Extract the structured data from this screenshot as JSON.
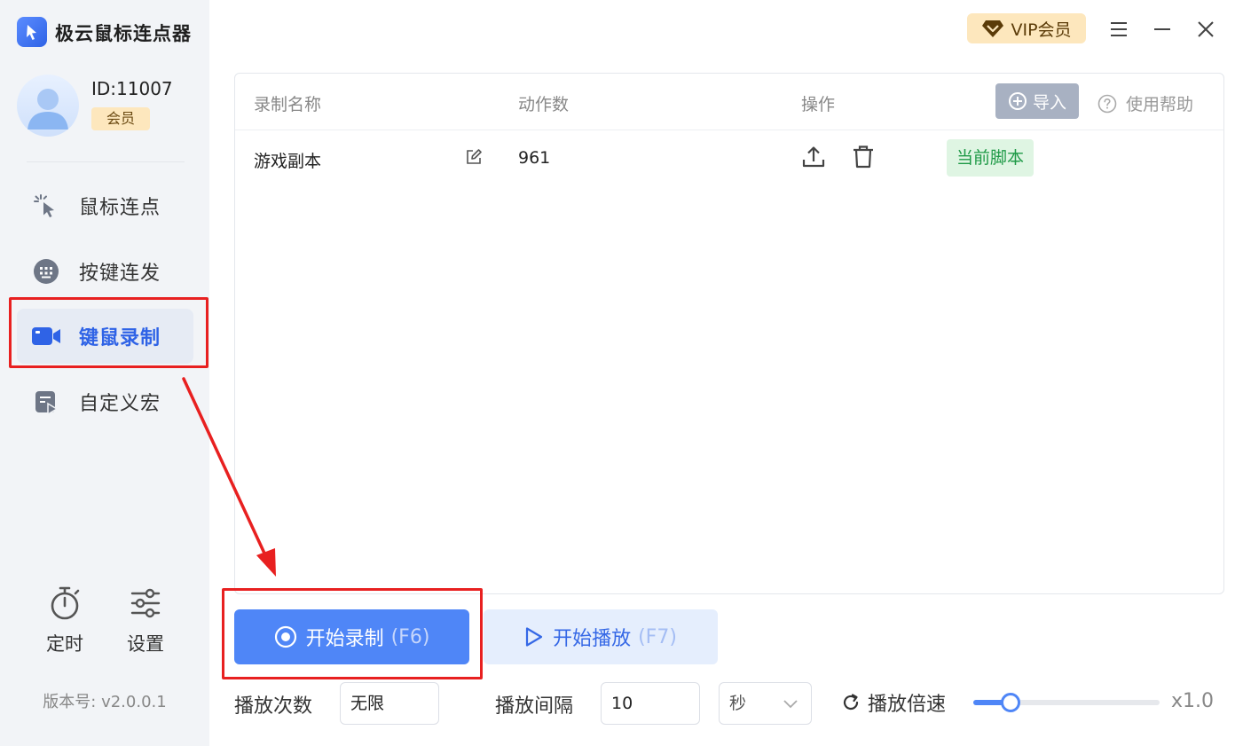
{
  "app": {
    "title": "极云鼠标连点器"
  },
  "user": {
    "id": "ID:11007",
    "badge": "会员"
  },
  "nav": {
    "items": [
      {
        "label": "鼠标连点",
        "icon": "mouse-click-icon"
      },
      {
        "label": "按键连发",
        "icon": "keyboard-icon"
      },
      {
        "label": "键鼠录制",
        "icon": "video-camera-icon",
        "active": true
      },
      {
        "label": "自定义宏",
        "icon": "macro-icon"
      }
    ]
  },
  "tools": {
    "timer": "定时",
    "settings": "设置"
  },
  "version": "版本号: v2.0.0.1",
  "header": {
    "vip": "VIP会员"
  },
  "table": {
    "columns": [
      "录制名称",
      "动作数",
      "操作"
    ],
    "import_label": "导入",
    "help_label": "使用帮助",
    "rows": [
      {
        "name": "游戏副本",
        "actions": "961",
        "tag": "当前脚本"
      }
    ]
  },
  "actions": {
    "record": {
      "label": "开始录制",
      "hotkey": "(F6)"
    },
    "play": {
      "label": "开始播放",
      "hotkey": "(F7)"
    }
  },
  "controls": {
    "play_count_label": "播放次数",
    "play_count_value": "无限",
    "interval_label": "播放间隔",
    "interval_value": "10",
    "interval_unit": "秒",
    "speed_label": "播放倍速",
    "speed_value": "x1.0",
    "speed_fraction": 0.2
  },
  "colors": {
    "accent": "#4f86f7",
    "annotation": "#e82020",
    "vip": "#fde7bd",
    "tag_green": "#1f9a47"
  }
}
